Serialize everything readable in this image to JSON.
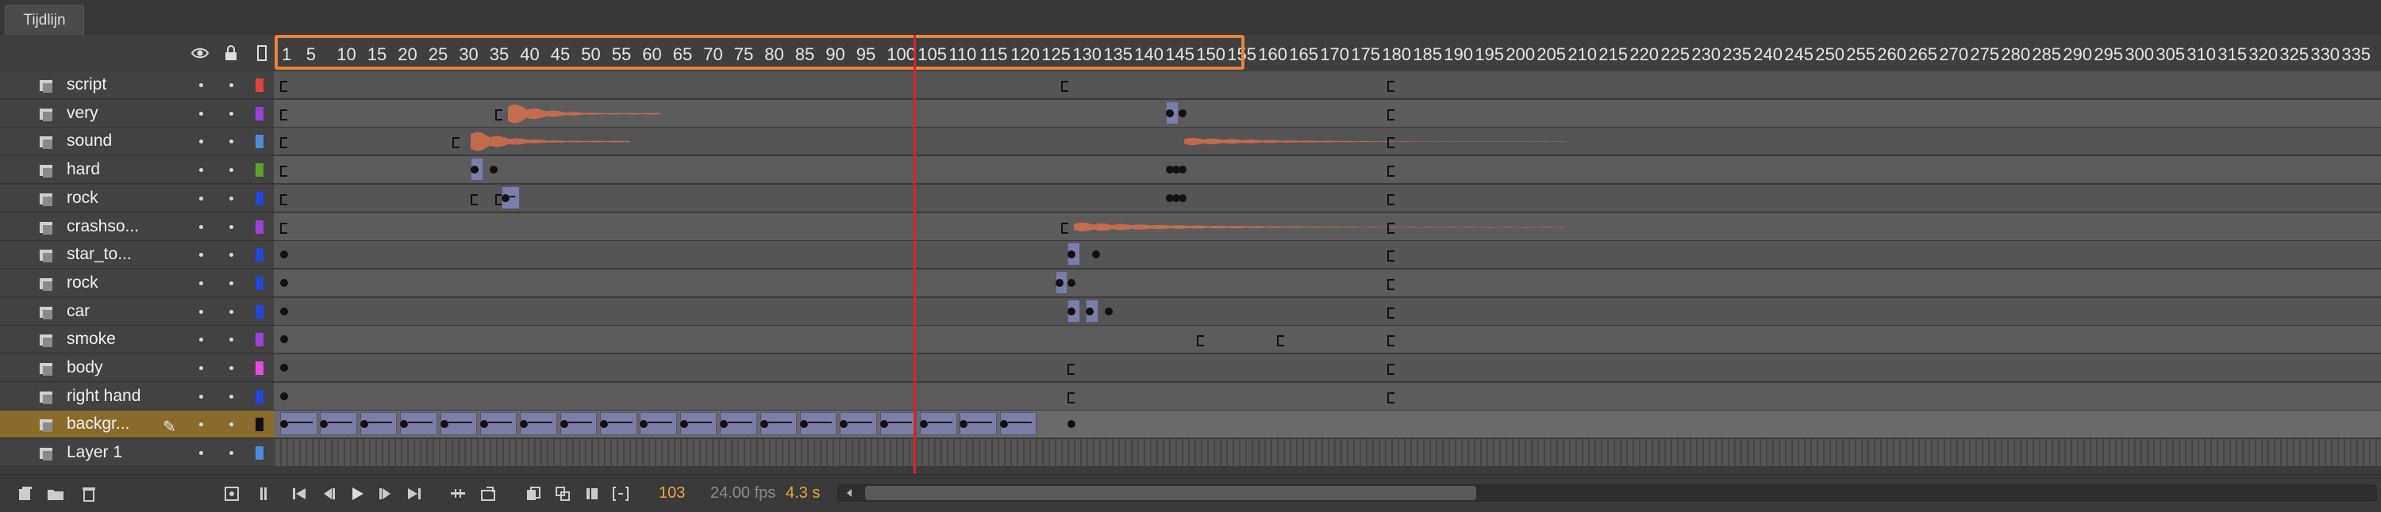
{
  "timeline": {
    "tab_label": "Tijdlijn",
    "ruler_labels": [
      "1",
      "5",
      "10",
      "15",
      "20",
      "25",
      "30",
      "35",
      "40",
      "45",
      "50",
      "55",
      "60",
      "65",
      "70",
      "75",
      "80",
      "85",
      "90",
      "95",
      "100",
      "105",
      "110",
      "115",
      "120",
      "125",
      "130",
      "135",
      "140",
      "145",
      "150",
      "155",
      "160",
      "165",
      "170",
      "175",
      "180",
      "185",
      "190",
      "195",
      "200",
      "205",
      "210",
      "215",
      "220",
      "225",
      "230",
      "235",
      "240",
      "245",
      "250",
      "255",
      "260",
      "265",
      "270",
      "275",
      "280",
      "285",
      "290",
      "295",
      "300",
      "305",
      "310",
      "315",
      "320",
      "325",
      "330",
      "335"
    ],
    "layers": [
      {
        "name": "script",
        "color": "#e2433f"
      },
      {
        "name": "very",
        "color": "#9a42d6"
      },
      {
        "name": "sound",
        "color": "#4f8ad6"
      },
      {
        "name": "hard",
        "color": "#5ca12c"
      },
      {
        "name": "rock",
        "color": "#2047d8"
      },
      {
        "name": "crashso...",
        "color": "#9a42d6"
      },
      {
        "name": "star_to...",
        "color": "#2047d8"
      },
      {
        "name": "rock",
        "color": "#2047d8"
      },
      {
        "name": "car",
        "color": "#2047d8"
      },
      {
        "name": "smoke",
        "color": "#9a42d6"
      },
      {
        "name": "body",
        "color": "#e24fe0"
      },
      {
        "name": "right hand",
        "color": "#2047d8"
      },
      {
        "name": "backgr...",
        "color": "#111111"
      },
      {
        "name": "Layer 1",
        "color": "#4f8ad6"
      }
    ],
    "active_layer_index": 12,
    "current_frame": "103",
    "fps": "24.00 fps",
    "elapsed": "4.3 s",
    "icons": {
      "header": [
        "eye-icon",
        "lock-icon",
        "outline-icon"
      ],
      "footer_left": [
        "new-layer-icon",
        "new-folder-icon",
        "delete-icon"
      ],
      "footer_controls": [
        "first-frame-icon",
        "step-back-icon",
        "play-icon",
        "step-forward-icon",
        "last-frame-icon"
      ]
    },
    "accent": "#e8833a",
    "playhead_color": "#d8242a"
  }
}
